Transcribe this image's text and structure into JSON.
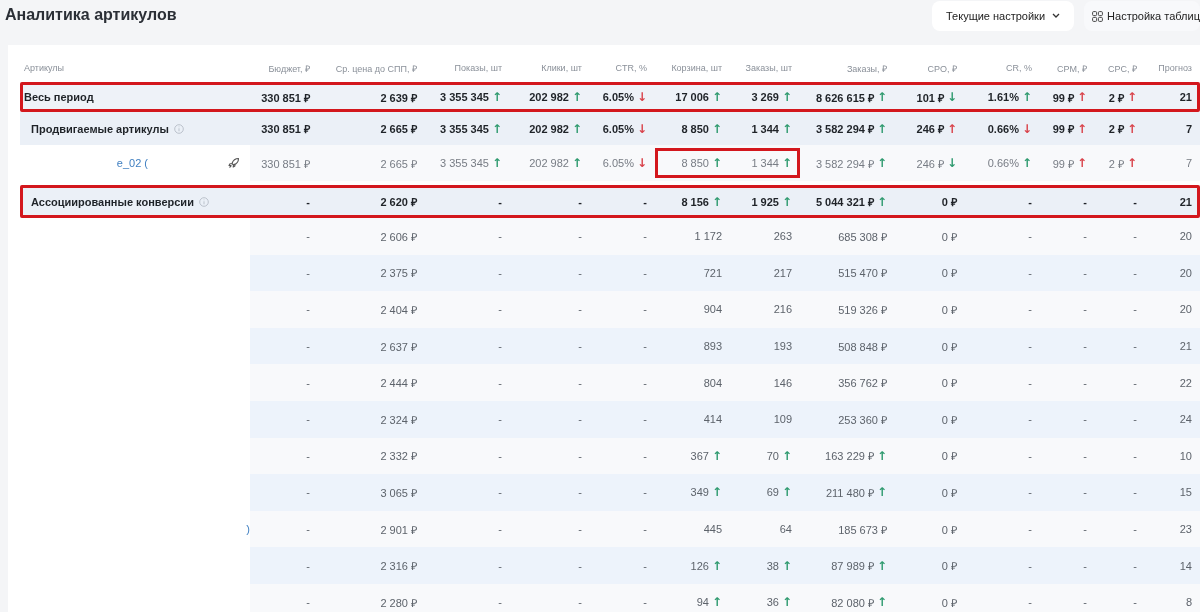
{
  "page_title": "Аналитика артикулов",
  "toolbar": {
    "preset_dropdown": "Текущие настройки",
    "table_settings_button": "Настройка таблиц"
  },
  "table": {
    "columns": [
      "Артикулы",
      "Бюджет, ₽",
      "Ср. цена до СПП, ₽",
      "Показы, шт",
      "Клики, шт",
      "CTR, %",
      "Корзина, шт",
      "Заказы, шт",
      "Заказы, ₽",
      "CPO, ₽",
      "CR, %",
      "CPM, ₽",
      "CPC, ₽",
      "Прогноз"
    ],
    "rows": [
      {
        "kind": "total",
        "framed": true,
        "cells": [
          "Весь период",
          "330 851 ₽",
          "2 639 ₽",
          {
            "text": "3 355 345",
            "trend": "↑",
            "color": "#2f9a6f"
          },
          {
            "text": "202 982",
            "trend": "↑",
            "color": "#2f9a6f"
          },
          {
            "text": "6.05%",
            "trend": "↓",
            "color": "#d9434b"
          },
          {
            "text": "17 006",
            "trend": "↑",
            "color": "#2f9a6f"
          },
          {
            "text": "3 269",
            "trend": "↑",
            "color": "#2f9a6f"
          },
          {
            "text": "8 626 615 ₽",
            "trend": "↑",
            "color": "#2f9a6f"
          },
          {
            "text": "101 ₽",
            "trend": "↓",
            "color": "#2f9a6f"
          },
          {
            "text": "1.61%",
            "trend": "↑",
            "color": "#2f9a6f"
          },
          {
            "text": "99 ₽",
            "trend": "↑",
            "color": "#d9434b"
          },
          {
            "text": "2 ₽",
            "trend": "↑",
            "color": "#d9434b"
          },
          "21"
        ]
      },
      {
        "kind": "group",
        "framed": false,
        "cells": [
          "Продвигаемые артикулы",
          "330 851 ₽",
          "2 665 ₽",
          {
            "text": "3 355 345",
            "trend": "↑",
            "color": "#2f9a6f"
          },
          {
            "text": "202 982",
            "trend": "↑",
            "color": "#2f9a6f"
          },
          {
            "text": "6.05%",
            "trend": "↓",
            "color": "#d9434b"
          },
          {
            "text": "8 850",
            "trend": "↑",
            "color": "#2f9a6f"
          },
          {
            "text": "1 344",
            "trend": "↑",
            "color": "#2f9a6f"
          },
          {
            "text": "3 582 294 ₽",
            "trend": "↑",
            "color": "#2f9a6f"
          },
          {
            "text": "246 ₽",
            "trend": "↑",
            "color": "#d9434b"
          },
          {
            "text": "0.66%",
            "trend": "↓",
            "color": "#d9434b"
          },
          {
            "text": "99 ₽",
            "trend": "↑",
            "color": "#d9434b"
          },
          {
            "text": "2 ₽",
            "trend": "↑",
            "color": "#d9434b"
          },
          "7"
        ]
      },
      {
        "kind": "item",
        "framed": false,
        "cells": [
          "e_02 (",
          "330 851 ₽",
          "2 665 ₽",
          {
            "text": "3 355 345",
            "trend": "↑",
            "color": "#2f9a6f"
          },
          {
            "text": "202 982",
            "trend": "↑",
            "color": "#2f9a6f"
          },
          {
            "text": "6.05%",
            "trend": "↓",
            "color": "#d9434b"
          },
          {
            "text": "8 850",
            "trend": "↑",
            "color": "#2f9a6f",
            "framed": true
          },
          {
            "text": "1 344",
            "trend": "↑",
            "color": "#2f9a6f",
            "framed": true
          },
          {
            "text": "3 582 294 ₽",
            "trend": "↑",
            "color": "#2f9a6f"
          },
          {
            "text": "246 ₽",
            "trend": "↓",
            "color": "#2f9a6f"
          },
          {
            "text": "0.66%",
            "trend": "↑",
            "color": "#2f9a6f"
          },
          {
            "text": "99 ₽",
            "trend": "↑",
            "color": "#d9434b"
          },
          {
            "text": "2 ₽",
            "trend": "↑",
            "color": "#d9434b"
          },
          "7"
        ]
      },
      {
        "kind": "group",
        "framed": true,
        "cells": [
          "Ассоциированные конверсии",
          "-",
          "2 620 ₽",
          "-",
          "-",
          "-",
          {
            "text": "8 156",
            "trend": "↑",
            "color": "#2f9a6f"
          },
          {
            "text": "1 925",
            "trend": "↑",
            "color": "#2f9a6f"
          },
          {
            "text": "5 044 321 ₽",
            "trend": "↑",
            "color": "#2f9a6f"
          },
          "0 ₽",
          "-",
          "-",
          "-",
          "21"
        ]
      },
      {
        "kind": "sub",
        "framed": false,
        "cells": [
          "",
          "-",
          "2 606 ₽",
          "-",
          "-",
          "-",
          "1 172",
          "263",
          "685 308 ₽",
          "0 ₽",
          "-",
          "-",
          "-",
          "20"
        ]
      },
      {
        "kind": "sub",
        "framed": false,
        "cells": [
          "",
          "-",
          "2 375 ₽",
          "-",
          "-",
          "-",
          "721",
          "217",
          "515 470 ₽",
          "0 ₽",
          "-",
          "-",
          "-",
          "20"
        ]
      },
      {
        "kind": "sub",
        "framed": false,
        "cells": [
          "",
          "-",
          "2 404 ₽",
          "-",
          "-",
          "-",
          "904",
          "216",
          "519 326 ₽",
          "0 ₽",
          "-",
          "-",
          "-",
          "20"
        ]
      },
      {
        "kind": "sub",
        "framed": false,
        "cells": [
          "",
          "-",
          "2 637 ₽",
          "-",
          "-",
          "-",
          "893",
          "193",
          "508 848 ₽",
          "0 ₽",
          "-",
          "-",
          "-",
          "21"
        ]
      },
      {
        "kind": "sub",
        "framed": false,
        "cells": [
          "",
          "-",
          "2 444 ₽",
          "-",
          "-",
          "-",
          "804",
          "146",
          "356 762 ₽",
          "0 ₽",
          "-",
          "-",
          "-",
          "22"
        ]
      },
      {
        "kind": "sub",
        "framed": false,
        "cells": [
          "",
          "-",
          "2 324 ₽",
          "-",
          "-",
          "-",
          "414",
          "109",
          "253 360 ₽",
          "0 ₽",
          "-",
          "-",
          "-",
          "24"
        ]
      },
      {
        "kind": "sub",
        "framed": false,
        "cells": [
          "",
          "-",
          "2 332 ₽",
          "-",
          "-",
          "-",
          {
            "text": "367",
            "trend": "↑",
            "color": "#2f9a6f"
          },
          {
            "text": "70",
            "trend": "↑",
            "color": "#2f9a6f"
          },
          {
            "text": "163 229 ₽",
            "trend": "↑",
            "color": "#2f9a6f"
          },
          "0 ₽",
          "-",
          "-",
          "-",
          "10"
        ]
      },
      {
        "kind": "sub",
        "framed": false,
        "cells": [
          "",
          "-",
          "3 065 ₽",
          "-",
          "-",
          "-",
          {
            "text": "349",
            "trend": "↑",
            "color": "#2f9a6f"
          },
          {
            "text": "69",
            "trend": "↑",
            "color": "#2f9a6f"
          },
          {
            "text": "211 480 ₽",
            "trend": "↑",
            "color": "#2f9a6f"
          },
          "0 ₽",
          "-",
          "-",
          "-",
          "15"
        ]
      },
      {
        "kind": "sub",
        "framed": false,
        "cells": [
          ")",
          "-",
          "2 901 ₽",
          "-",
          "-",
          "-",
          "445",
          "64",
          "185 673 ₽",
          "0 ₽",
          "-",
          "-",
          "-",
          "23"
        ]
      },
      {
        "kind": "sub",
        "framed": false,
        "cells": [
          "",
          "-",
          "2 316 ₽",
          "-",
          "-",
          "-",
          {
            "text": "126",
            "trend": "↑",
            "color": "#2f9a6f"
          },
          {
            "text": "38",
            "trend": "↑",
            "color": "#2f9a6f"
          },
          {
            "text": "87 989 ₽",
            "trend": "↑",
            "color": "#2f9a6f"
          },
          "0 ₽",
          "-",
          "-",
          "-",
          "14"
        ]
      },
      {
        "kind": "sub",
        "framed": false,
        "cells": [
          "",
          "-",
          "2 280 ₽",
          "-",
          "-",
          "-",
          {
            "text": "94",
            "trend": "↑",
            "color": "#2f9a6f"
          },
          {
            "text": "36",
            "trend": "↑",
            "color": "#2f9a6f"
          },
          {
            "text": "82 080 ₽",
            "trend": "↑",
            "color": "#2f9a6f"
          },
          "0 ₽",
          "-",
          "-",
          "-",
          "8"
        ]
      }
    ]
  }
}
